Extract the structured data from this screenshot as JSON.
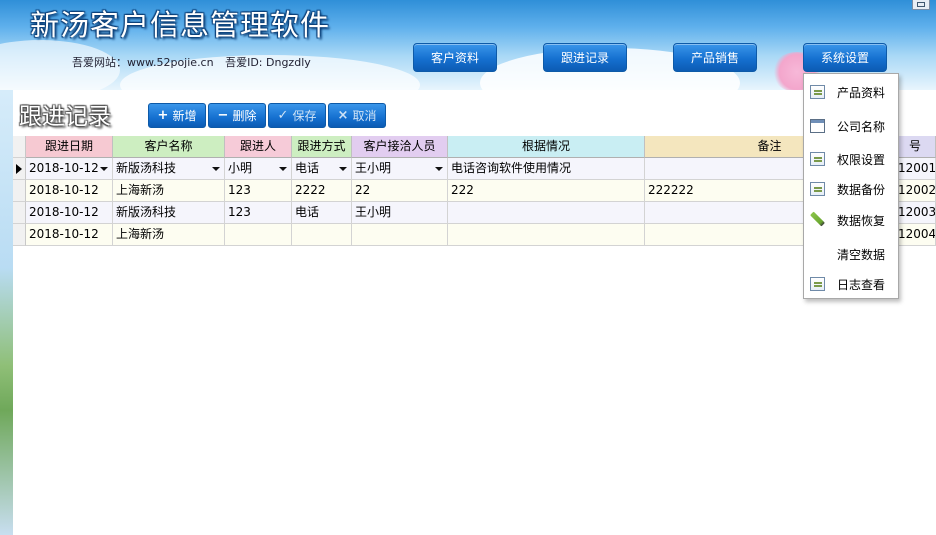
{
  "app": {
    "title": "新汤客户信息管理软件",
    "site_label": "吾爱网站：www.52pojie.cn",
    "id_label": "吾爱ID: Dngzdly"
  },
  "nav": {
    "customer_info": "客户资料",
    "follow_up": "跟进记录",
    "product_sales": "产品销售",
    "system_settings": "系统设置"
  },
  "page": {
    "title": "跟进记录"
  },
  "toolbar": {
    "add": "新增",
    "delete": "删除",
    "save": "保存",
    "cancel": "取消"
  },
  "grid": {
    "columns": [
      "跟进日期",
      "客户名称",
      "跟进人",
      "跟进方式",
      "客户接洽人员",
      "根据情况",
      "备注",
      "号"
    ],
    "rows": [
      [
        "2018-10-12",
        "新版汤科技",
        "小明",
        "电话",
        "王小明",
        "电话咨询软件使用情况",
        "",
        "12001"
      ],
      [
        "2018-10-12",
        "上海新汤",
        "123",
        "2222",
        "22",
        "222",
        "222222",
        "12002"
      ],
      [
        "2018-10-12",
        "新版汤科技",
        "123",
        "电话",
        "王小明",
        "",
        "",
        "12003"
      ],
      [
        "2018-10-12",
        "上海新汤",
        "",
        "",
        "",
        "",
        "",
        "12004"
      ]
    ]
  },
  "menu": {
    "items": [
      {
        "label": "产品资料",
        "icon": "document-check-icon"
      },
      {
        "label": "公司名称",
        "icon": "window-icon"
      },
      {
        "label": "权限设置",
        "icon": "document-check-icon"
      },
      {
        "label": "数据备份",
        "icon": "document-check-icon"
      },
      {
        "label": "数据恢复",
        "icon": "pencil-icon"
      },
      {
        "label": "清空数据",
        "icon": ""
      },
      {
        "label": "日志查看",
        "icon": "log-edit-icon"
      }
    ]
  },
  "colors": {
    "header_date": "#f6c9d2",
    "header_customer": "#cdeec1",
    "header_person": "#f6cbd8",
    "header_method": "#cdeec1",
    "header_contact": "#e2cdf0",
    "header_situation": "#c9eef3",
    "header_note": "#f4e6be",
    "header_no": "#dcd9f2",
    "row_alt": "#fdfdf1",
    "row_normal": "#f5f5fc"
  }
}
